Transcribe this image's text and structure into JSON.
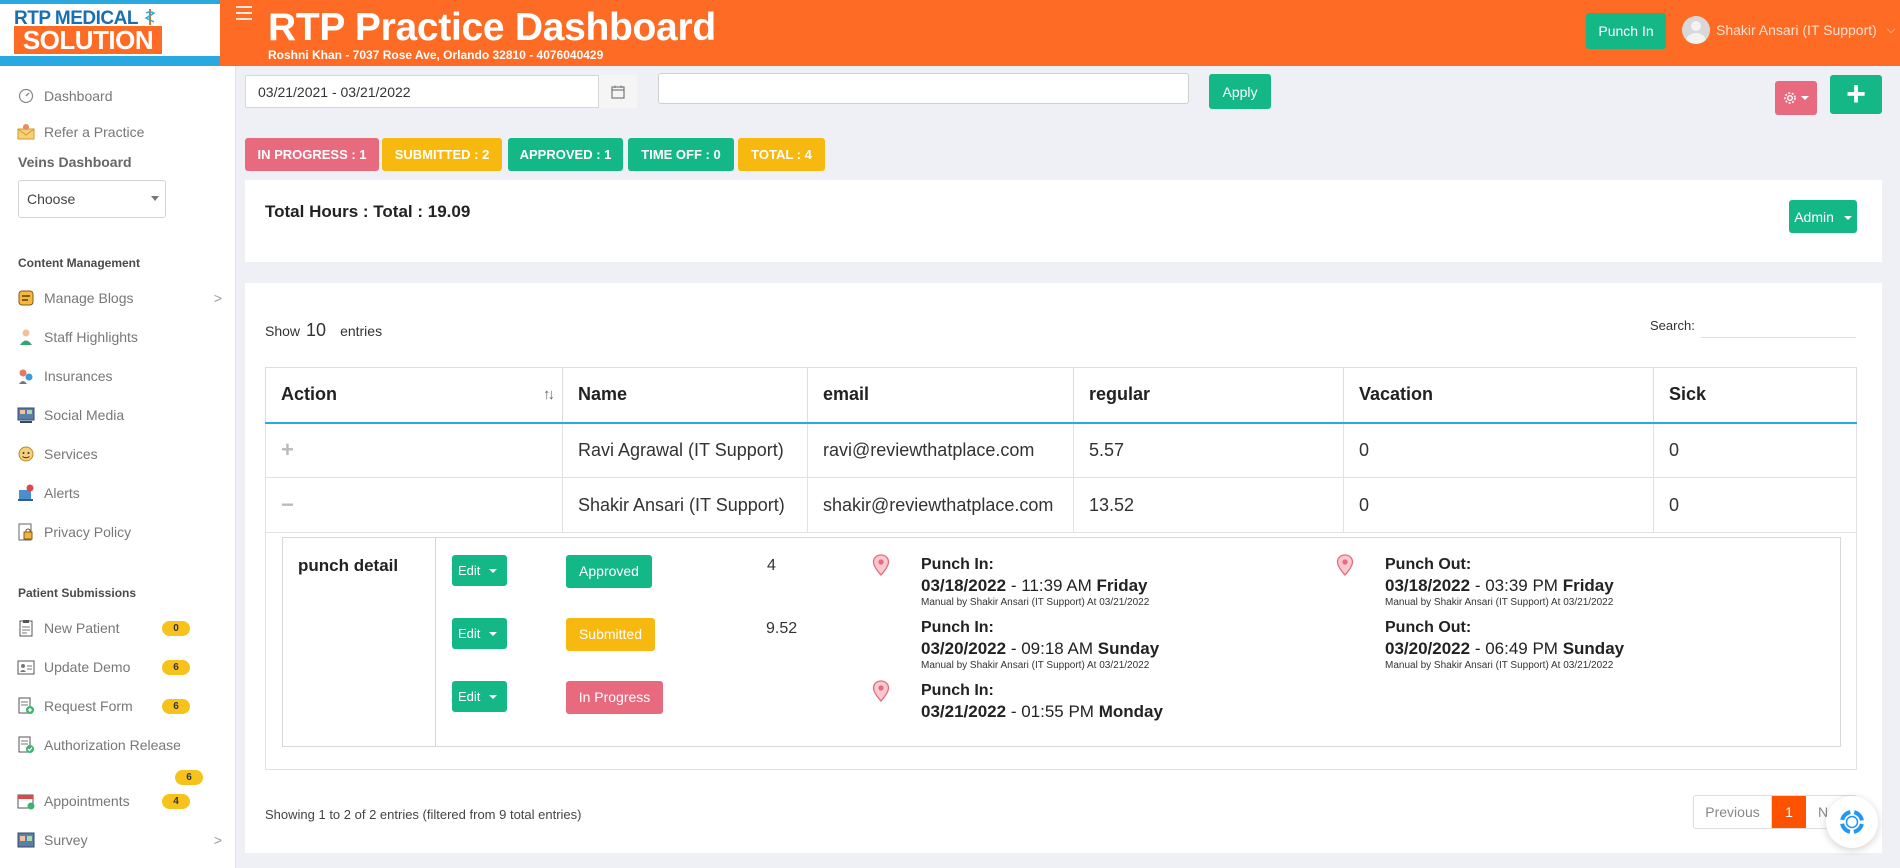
{
  "header": {
    "logo_line1": "RTP MEDICAL",
    "logo_line2": "SOLUTION",
    "title": "RTP Practice Dashboard",
    "subtitle": "Roshni Khan - 7037 Rose Ave, Orlando 32810 - 4076040429",
    "punch_in_label": "Punch In",
    "user_name": "Shakir Ansari (IT Support)"
  },
  "sidebar": {
    "top_items": [
      {
        "label": "Dashboard",
        "icon": "dashboard-gauge-icon"
      },
      {
        "label": "Refer a Practice",
        "icon": "refer-envelope-icon"
      }
    ],
    "veins_heading": "Veins Dashboard",
    "veins_select": "Choose",
    "content_heading": "Content Management",
    "content_items": [
      {
        "label": "Manage Blogs",
        "icon": "blog-icon",
        "has_arrow": true
      },
      {
        "label": "Staff Highlights",
        "icon": "staff-icon"
      },
      {
        "label": "Insurances",
        "icon": "insurance-icon"
      },
      {
        "label": "Social Media",
        "icon": "social-media-icon"
      },
      {
        "label": "Services",
        "icon": "services-icon"
      },
      {
        "label": "Alerts",
        "icon": "alerts-icon"
      },
      {
        "label": "Privacy Policy",
        "icon": "privacy-lock-icon"
      }
    ],
    "patient_heading": "Patient Submissions",
    "patient_items": [
      {
        "label": "New Patient",
        "badge": "0",
        "icon": "clipboard-icon"
      },
      {
        "label": "Update Demo",
        "badge": "6",
        "icon": "id-card-icon"
      },
      {
        "label": "Request Form",
        "badge": "6",
        "icon": "form-add-icon"
      },
      {
        "label": "Authorization Release",
        "badge": "6",
        "icon": "form-check-icon"
      },
      {
        "label": "Appointments",
        "badge": "4",
        "icon": "calendar-icon"
      },
      {
        "label": "Survey",
        "icon": "survey-icon",
        "has_arrow": true
      }
    ],
    "arrow": ">"
  },
  "toolbar": {
    "date_range": "03/21/2021 - 03/21/2022",
    "search_value": "",
    "apply_label": "Apply",
    "plus_label": "+"
  },
  "status_pills": [
    {
      "label": "IN PROGRESS : 1",
      "color": "#e86a7f"
    },
    {
      "label": "SUBMITTED : 2",
      "color": "#f7b80f"
    },
    {
      "label": "APPROVED : 1",
      "color": "#14b887"
    },
    {
      "label": "TIME OFF : 0",
      "color": "#14b887"
    },
    {
      "label": "TOTAL : 4",
      "color": "#f7b80f"
    }
  ],
  "summary": {
    "total_hours": "Total Hours : Total : 19.09",
    "admin_label": "Admin"
  },
  "table": {
    "show_label": "Show",
    "page_size": "10",
    "entries_label": "entries",
    "search_label": "Search:",
    "sort_glyph": "↑↓",
    "columns": [
      "Action",
      "Name",
      "email",
      "regular",
      "Vacation",
      "Sick"
    ],
    "rows": [
      {
        "action": "+",
        "name": "Ravi Agrawal (IT Support)",
        "email": "ravi@reviewthatplace.com",
        "regular": "5.57",
        "vacation": "0",
        "sick": "0"
      },
      {
        "action": "−",
        "name": "Shakir Ansari (IT Support)",
        "email": "shakir@reviewthatplace.com",
        "regular": "13.52",
        "vacation": "0",
        "sick": "0"
      }
    ],
    "footer_info": "Showing 1 to 2 of 2 entries (filtered from 9 total entries)",
    "pager": {
      "prev": "Previous",
      "current": "1",
      "next": "Next"
    }
  },
  "punch_detail": {
    "label": "punch detail",
    "entries": [
      {
        "edit_label": "Edit",
        "status": "Approved",
        "status_color": "#14b887",
        "hours": "4",
        "in_title": "Punch In:",
        "in_date": "03/18/2022",
        "in_time": " - 11:39 AM ",
        "in_day": "Friday",
        "in_note": "Manual by Shakir Ansari (IT Support) At 03/21/2022",
        "out_title": "Punch Out:",
        "out_date": "03/18/2022",
        "out_time": " - 03:39 PM ",
        "out_day": "Friday",
        "out_note": "Manual by Shakir Ansari (IT Support) At 03/21/2022"
      },
      {
        "edit_label": "Edit",
        "status": "Submitted",
        "status_color": "#f7b80f",
        "hours": "9.52",
        "in_title": "Punch In:",
        "in_date": "03/20/2022",
        "in_time": " - 09:18 AM ",
        "in_day": "Sunday",
        "in_note": "Manual by Shakir Ansari (IT Support) At 03/21/2022",
        "out_title": "Punch Out:",
        "out_date": "03/20/2022",
        "out_time": " - 06:49 PM ",
        "out_day": "Sunday",
        "out_note": "Manual by Shakir Ansari (IT Support) At 03/21/2022"
      },
      {
        "edit_label": "Edit",
        "status": "In Progress",
        "status_color": "#e86a7f",
        "in_title": "Punch In:",
        "in_date": "03/21/2022",
        "in_time": " - 01:55 PM ",
        "in_day": "Monday"
      }
    ]
  },
  "colors": {
    "brand_orange": "#fd6b25",
    "brand_green": "#14b887",
    "brand_blue": "#2aa8e0",
    "danger_pink": "#e86a7f",
    "warning_yellow": "#f7b80f"
  }
}
